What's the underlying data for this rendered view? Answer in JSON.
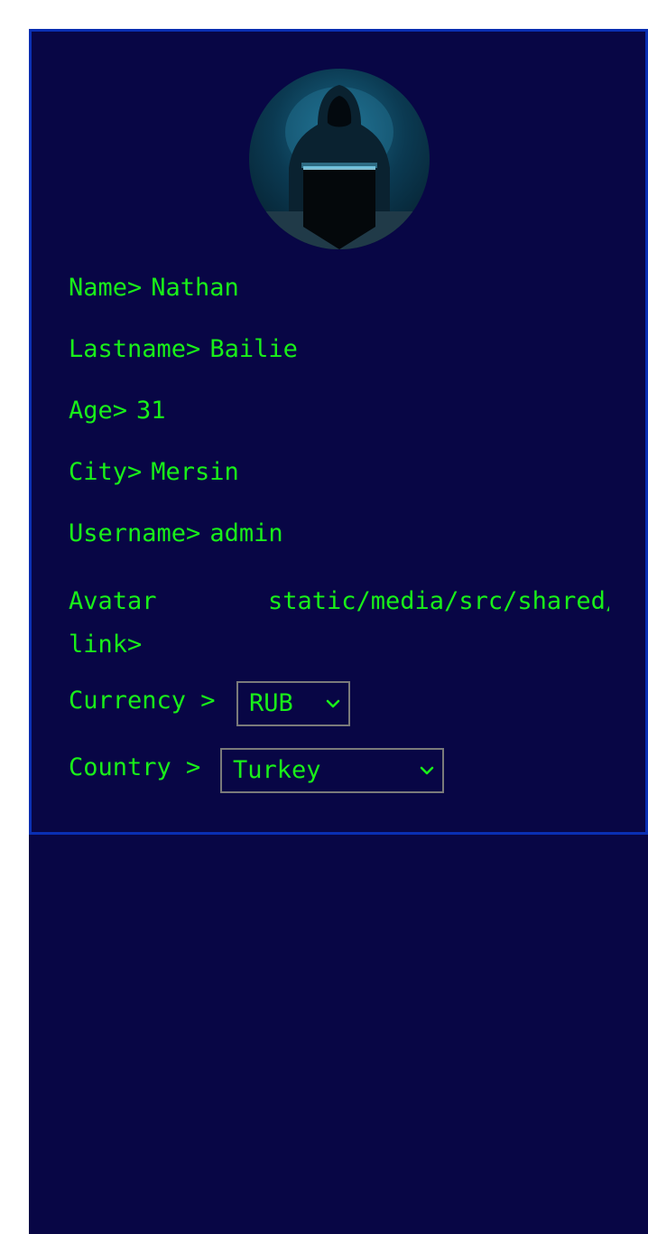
{
  "profile": {
    "name_label": "Name>",
    "name_value": "Nathan",
    "lastname_label": "Lastname>",
    "lastname_value": "Bailie",
    "age_label": "Age>",
    "age_value": "31",
    "city_label": "City>",
    "city_value": "Mersin",
    "username_label": "Username>",
    "username_value": "admin",
    "avatar_label": "Avatar link>",
    "avatar_value": "static/media/src/shared/avatar.png",
    "currency_label": "Currency >",
    "currency_value": "RUB",
    "country_label": "Country >",
    "country_value": "Turkey"
  },
  "icons": {
    "avatar": "hooded-hacker-avatar",
    "chevron": "chevron-down-icon"
  },
  "colors": {
    "background": "#080645",
    "border": "#0a2fb3",
    "text": "#19f019",
    "select_border": "#7a7a7a"
  }
}
